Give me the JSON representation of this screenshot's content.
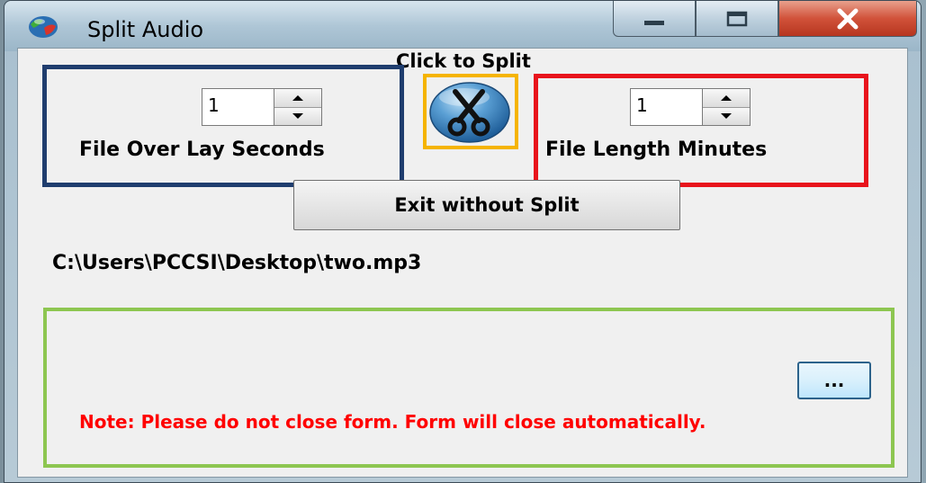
{
  "window": {
    "title": "Split Audio"
  },
  "controls": {
    "click_to_split_label": "Click to Split",
    "overlay_seconds": {
      "value": "1",
      "label": "File Over Lay Seconds"
    },
    "length_minutes": {
      "value": "1",
      "label": "File Length Minutes"
    },
    "exit_button_label": "Exit without Split",
    "file_path": "C:\\Users\\PCCSI\\Desktop\\two.mp3",
    "browse_button_label": "...",
    "note": "Note: Please do not close form. Form will close automatically."
  },
  "icons": {
    "app": "globe-icon",
    "split": "scissors-icon",
    "minimize": "minimize-icon",
    "maximize": "maximize-icon",
    "close": "close-icon",
    "spin_up": "arrow-up-icon",
    "spin_down": "arrow-down-icon"
  },
  "colors": {
    "highlight_blue": "#1f3d6e",
    "highlight_orange": "#f5b400",
    "highlight_red": "#e8141c",
    "highlight_green": "#8dc651",
    "note_text": "#ff0000",
    "close_button": "#c9432b"
  }
}
